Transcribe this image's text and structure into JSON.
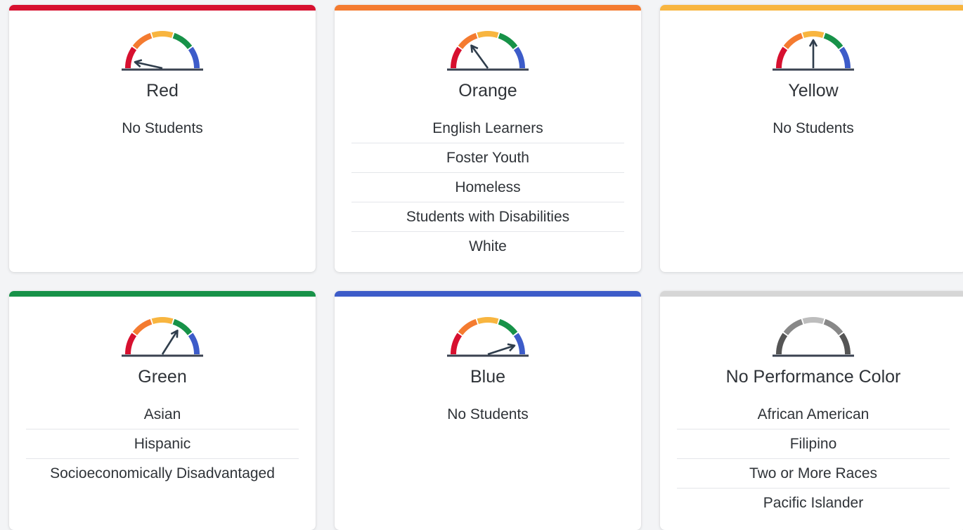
{
  "cards": [
    {
      "id": "red",
      "title": "Red",
      "accent": "#d7102f",
      "needle_level": 0.07,
      "gauge_style": "color",
      "groups": [
        "No Students"
      ]
    },
    {
      "id": "orange",
      "title": "Orange",
      "accent": "#f47b30",
      "needle_level": 0.3,
      "gauge_style": "color",
      "groups": [
        "English Learners",
        "Foster Youth",
        "Homeless",
        "Students with Disabilities",
        "White"
      ]
    },
    {
      "id": "yellow",
      "title": "Yellow",
      "accent": "#f8b53f",
      "needle_level": 0.5,
      "gauge_style": "color",
      "groups": [
        "No Students"
      ]
    },
    {
      "id": "green",
      "title": "Green",
      "accent": "#179248",
      "needle_level": 0.68,
      "gauge_style": "color",
      "groups": [
        "Asian",
        "Hispanic",
        "Socioeconomically Disadvantaged"
      ]
    },
    {
      "id": "blue",
      "title": "Blue",
      "accent": "#3d5cc9",
      "needle_level": 0.9,
      "gauge_style": "color",
      "groups": [
        "No Students"
      ]
    },
    {
      "id": "no-color",
      "title": "No Performance Color",
      "accent": "#d6d6d6",
      "needle_level": null,
      "gauge_style": "gray",
      "groups": [
        "African American",
        "Filipino",
        "Two or More Races",
        "Pacific Islander"
      ]
    }
  ],
  "gauge_colors": {
    "color": [
      "#d7102f",
      "#f47b30",
      "#f8b53f",
      "#179248",
      "#3d5cc9"
    ],
    "gray": [
      "#555555",
      "#888888",
      "#bdbdbd",
      "#888888",
      "#555555"
    ],
    "needle": "#2f3d4c",
    "base": "#3a4250"
  }
}
